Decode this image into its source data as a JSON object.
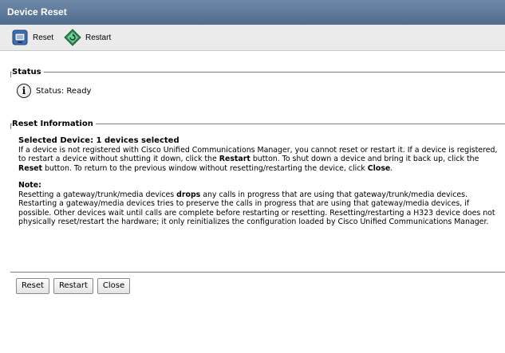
{
  "window": {
    "title": "Device Reset"
  },
  "toolbar": {
    "reset_label": "Reset",
    "restart_label": "Restart",
    "reset_icon": "reset-device-icon",
    "restart_icon": "restart-device-icon"
  },
  "status": {
    "legend": "Status",
    "icon": "info-icon",
    "text": "Status: Ready"
  },
  "reset_info": {
    "legend": "Reset Information",
    "selected_heading": "Selected Device: 1 devices selected",
    "para1": [
      "If a device is not registered with Cisco Unified Communications Manager, you cannot reset or restart it. If a device is registered, to restart a device without shutting it down, click the ",
      "Restart",
      " button. To shut down a device and bring it back up, click the ",
      "Reset",
      " button. To return to the previous window without resetting/restarting the device, click ",
      "Close",
      "."
    ],
    "note_heading": "Note:",
    "para2": [
      "Resetting a gateway/trunk/media devices ",
      "drops",
      " any calls in progress that are using that gateway/trunk/media devices. Restarting a gateway/media devices tries to preserve the calls in progress that are using that gateway/media devices, if possible. Other devices wait until calls are complete before restarting or resetting. Resetting/restarting a H323 device does not physically reset/restart the hardware; it only reinitializes the configuration loaded by Cisco Unified Communications Manager."
    ]
  },
  "buttons": {
    "reset": "Reset",
    "restart": "Restart",
    "close": "Close"
  },
  "colors": {
    "titlebar": "#5a7698",
    "toolbar_bg": "#ebebeb"
  }
}
